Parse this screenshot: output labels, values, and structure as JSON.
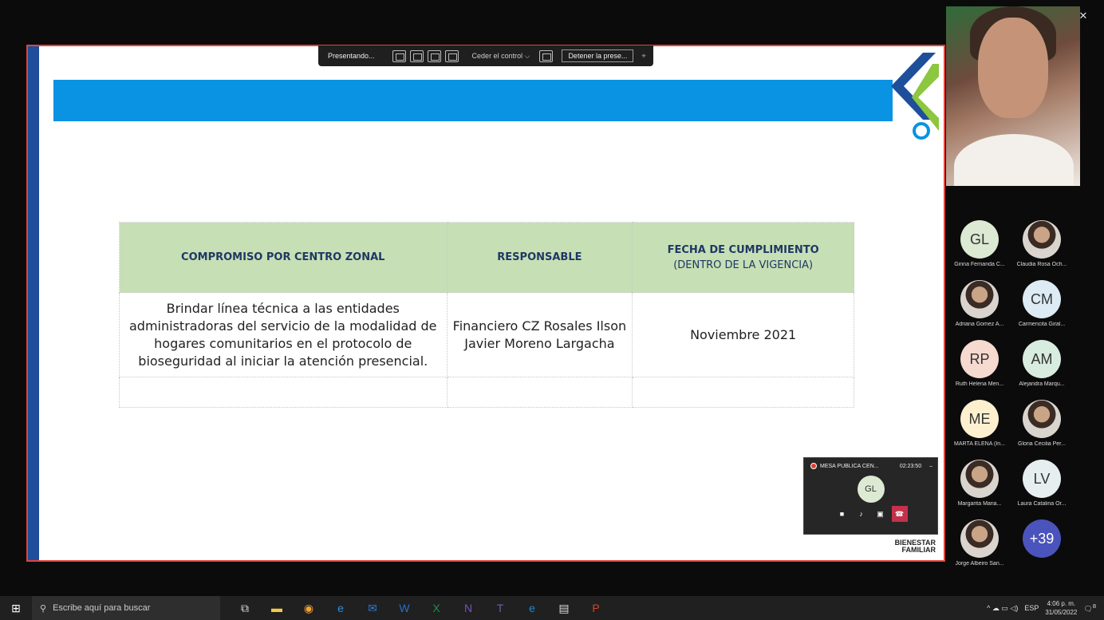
{
  "window": {
    "controls": [
      "–",
      "❐",
      "✕"
    ]
  },
  "present_toolbar": {
    "presenting_label": "Presentando...",
    "give_control": "Ceder el control",
    "give_control_chevron": "⌵",
    "stop_label": "Detener la prese...",
    "pin_icon": "⌖"
  },
  "slide": {
    "table": {
      "headers": {
        "col1": "COMPROMISO POR CENTRO ZONAL",
        "col2": "RESPONSABLE",
        "col3": "FECHA DE CUMPLIMIENTO",
        "col3_sub": "(DENTRO DE LA VIGENCIA)"
      },
      "row1": {
        "commitment": "Brindar línea técnica a las entidades administradoras del servicio de la modalidad de hogares comunitarios en el protocolo de bioseguridad al iniciar la atención presencial.",
        "responsible": "Financiero CZ Rosales Ilson Javier Moreno Largacha",
        "date": "Noviembre 2021"
      }
    },
    "footer_logo": {
      "line1": "BIENESTAR",
      "line2": "FAMILIAR"
    }
  },
  "participants": [
    {
      "initials": "GL",
      "name": "Ginna Fernanda C...",
      "bg": "#dce9d3"
    },
    {
      "initials": "",
      "name": "Claudia Rosa Och...",
      "bg": "photo"
    },
    {
      "initials": "",
      "name": "Adriana Gomez A...",
      "bg": "photo"
    },
    {
      "initials": "CM",
      "name": "Carmencita Giral...",
      "bg": "#dcebf4"
    },
    {
      "initials": "RP",
      "name": "Ruth Helena Men...",
      "bg": "#f6d9cf"
    },
    {
      "initials": "AM",
      "name": "Alejandra Marqu...",
      "bg": "#d8ecdf"
    },
    {
      "initials": "ME",
      "name": "MARTA ELENA (In...",
      "bg": "#fdf0cf"
    },
    {
      "initials": "",
      "name": "Gloria Cecilia Per...",
      "bg": "photo"
    },
    {
      "initials": "",
      "name": "Margarita Maria...",
      "bg": "photo"
    },
    {
      "initials": "LV",
      "name": "Laura Catalina Or...",
      "bg": "#e6eef0"
    },
    {
      "initials": "",
      "name": "Jorge Albeiro San...",
      "bg": "photo"
    },
    {
      "initials": "+39",
      "name": "",
      "bg": "#4b53bc"
    }
  ],
  "mini_call": {
    "title": "MESA PUBLICA CEN...",
    "time": "02:23:50",
    "minimize": "–",
    "avatar_initials": "GL",
    "buttons": [
      "■",
      "♪",
      "▣",
      "☎"
    ]
  },
  "taskbar": {
    "start_icon": "⊞",
    "search_icon": "⚲",
    "search_placeholder": "Escribe aquí para buscar",
    "apps": [
      {
        "icon": "task-view-icon",
        "glyph": "⧉",
        "color": "#ddd"
      },
      {
        "icon": "file-explorer-icon",
        "glyph": "▬",
        "color": "#f2c94c"
      },
      {
        "icon": "chrome-icon",
        "glyph": "◉",
        "color": "#f2a33a"
      },
      {
        "icon": "edge-icon",
        "glyph": "e",
        "color": "#2d8ee0"
      },
      {
        "icon": "outlook-icon",
        "glyph": "✉",
        "color": "#2f7bd6"
      },
      {
        "icon": "word-icon",
        "glyph": "W",
        "color": "#2b6cc9"
      },
      {
        "icon": "excel-icon",
        "glyph": "X",
        "color": "#1f8f4e"
      },
      {
        "icon": "onenote-icon",
        "glyph": "N",
        "color": "#7a4fc2"
      },
      {
        "icon": "teams-icon",
        "glyph": "T",
        "color": "#6264a7"
      },
      {
        "icon": "edge-legacy-icon",
        "glyph": "e",
        "color": "#1a88d9"
      },
      {
        "icon": "movie-icon",
        "glyph": "▤",
        "color": "#ddd"
      },
      {
        "icon": "powerpoint-icon",
        "glyph": "P",
        "color": "#d24726"
      }
    ],
    "tray": {
      "icons": "^ ☁ ▭ ◁)",
      "language": "ESP",
      "time": "4:06 p. m.",
      "date": "31/05/2022",
      "notifications": "8"
    }
  }
}
